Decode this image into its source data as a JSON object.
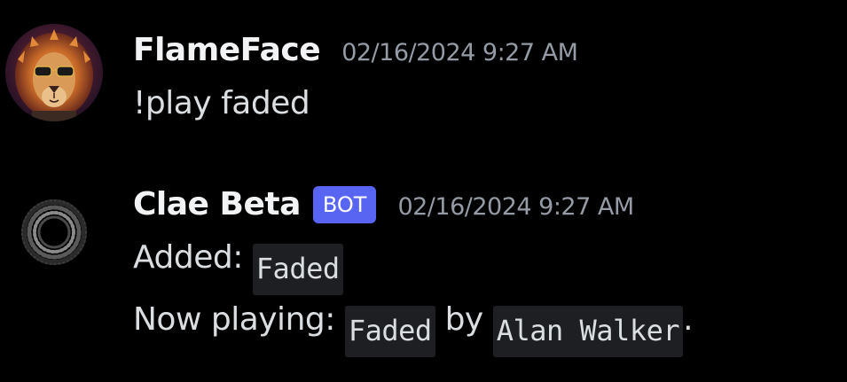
{
  "messages": [
    {
      "author": "FlameFace",
      "timestamp": "02/16/2024 9:27 AM",
      "avatar_icon": "lion-avatar",
      "content": "!play faded"
    },
    {
      "author": "Clae Beta",
      "bot_tag": "BOT",
      "timestamp": "02/16/2024 9:27 AM",
      "avatar_icon": "black-hole-avatar",
      "lines": {
        "added_prefix": "Added: ",
        "added_track": "Faded",
        "now_playing_prefix": "Now playing: ",
        "now_playing_track": "Faded",
        "by_word": " by ",
        "now_playing_artist": "Alan Walker",
        "trailing_period": "."
      }
    }
  ],
  "colors": {
    "background": "#000000",
    "username": "#f2f3f5",
    "timestamp": "#949ba4",
    "text": "#dbdee1",
    "bot_tag_bg": "#5865f2",
    "code_bg": "#1e1f22"
  }
}
